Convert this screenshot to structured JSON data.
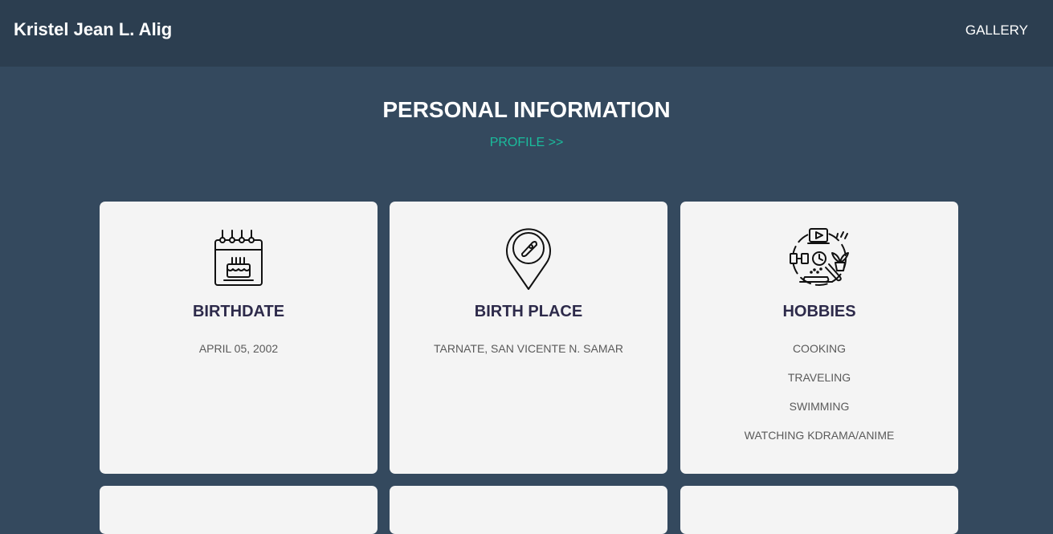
{
  "header": {
    "brand": "Kristel Jean L. Alig",
    "nav": [
      {
        "label": "GALLERY"
      }
    ]
  },
  "section": {
    "title": "PERSONAL INFORMATION",
    "link": "PROFILE >>"
  },
  "cards": [
    {
      "title": "BIRTHDATE",
      "icon": "birthday-calendar-icon",
      "values": [
        "APRIL 05, 2002"
      ]
    },
    {
      "title": "BIRTH PLACE",
      "icon": "location-pin-icon",
      "values": [
        "TARNATE, SAN VICENTE N. SAMAR"
      ]
    },
    {
      "title": "HOBBIES",
      "icon": "hobbies-icon",
      "values": [
        "COOKING",
        "TRAVELING",
        "SWIMMING",
        "WATCHING KDRAMA/ANIME"
      ]
    }
  ],
  "colors": {
    "header_bg": "#2c3e50",
    "page_bg": "#34495e",
    "accent": "#1abc9c",
    "card_bg": "#f4f4f4",
    "card_title": "#2d2a4a"
  }
}
